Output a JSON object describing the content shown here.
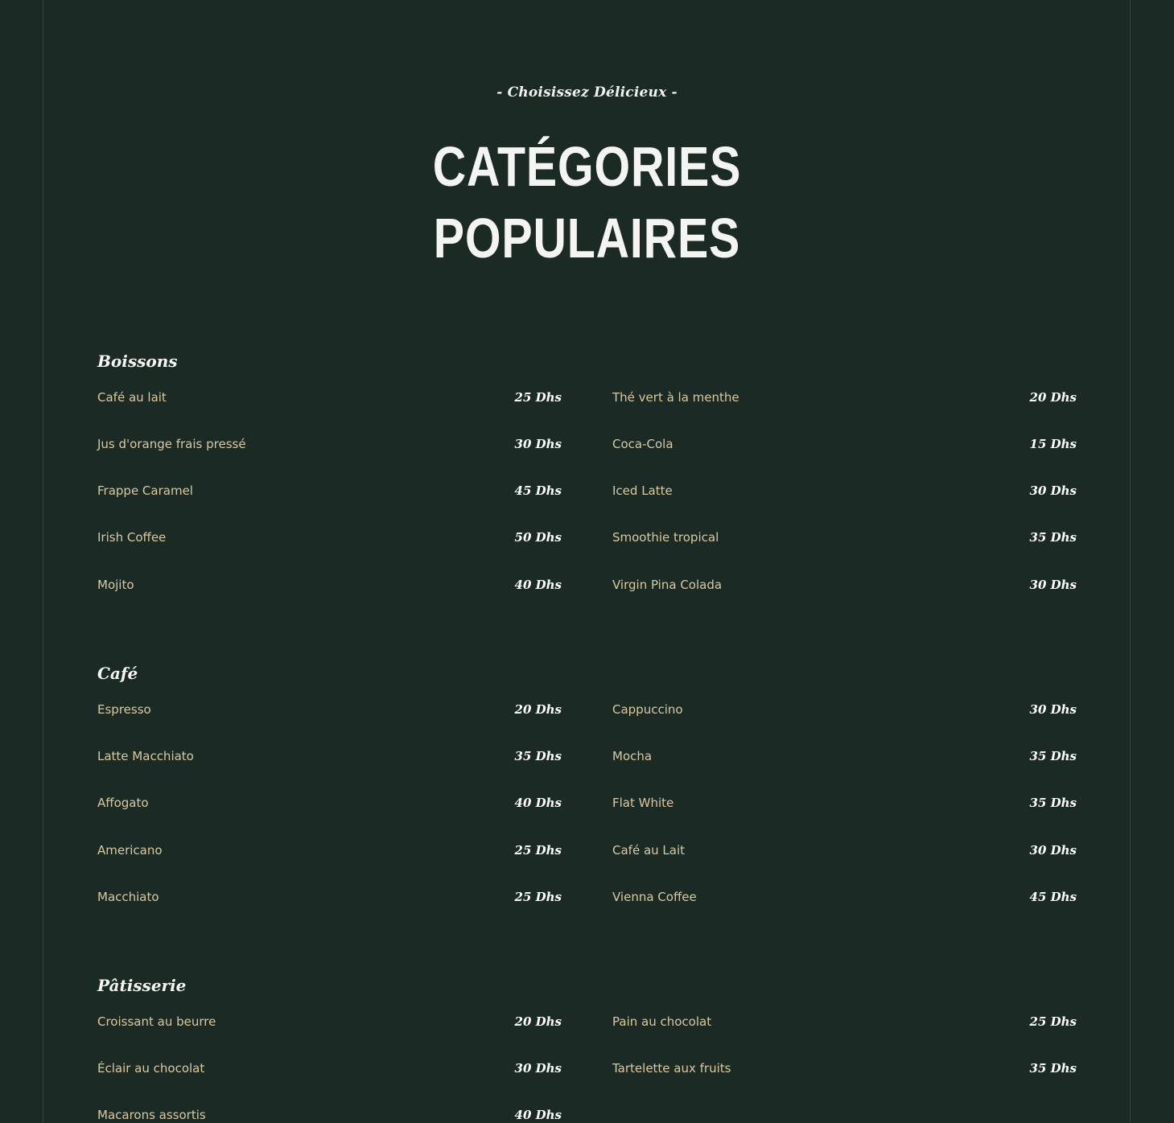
{
  "header": {
    "subtitle": "- Choisissez Délicieux -",
    "title_line1": "Catégories",
    "title_line2": "Populaires"
  },
  "colors": {
    "background": "#1b2a25",
    "item_name": "#d9c9a0",
    "price": "#ffffff",
    "heading": "#f4f4f2"
  },
  "categories": [
    {
      "name": "Boissons",
      "left": [
        {
          "name": "Café au lait",
          "price": "25 Dhs"
        },
        {
          "name": "Jus d'orange frais pressé",
          "price": "30 Dhs"
        },
        {
          "name": "Frappe Caramel",
          "price": "45 Dhs"
        },
        {
          "name": "Irish Coffee",
          "price": "50 Dhs"
        },
        {
          "name": "Mojito",
          "price": "40 Dhs"
        }
      ],
      "right": [
        {
          "name": "Thé vert à la menthe",
          "price": "20 Dhs"
        },
        {
          "name": "Coca-Cola",
          "price": "15 Dhs"
        },
        {
          "name": "Iced Latte",
          "price": "30 Dhs"
        },
        {
          "name": "Smoothie tropical",
          "price": "35 Dhs"
        },
        {
          "name": "Virgin Pina Colada",
          "price": "30 Dhs"
        }
      ]
    },
    {
      "name": "Café",
      "left": [
        {
          "name": "Espresso",
          "price": "20 Dhs"
        },
        {
          "name": "Latte Macchiato",
          "price": "35 Dhs"
        },
        {
          "name": "Affogato",
          "price": "40 Dhs"
        },
        {
          "name": "Americano",
          "price": "25 Dhs"
        },
        {
          "name": "Macchiato",
          "price": "25 Dhs"
        }
      ],
      "right": [
        {
          "name": "Cappuccino",
          "price": "30 Dhs"
        },
        {
          "name": "Mocha",
          "price": "35 Dhs"
        },
        {
          "name": "Flat White",
          "price": "35 Dhs"
        },
        {
          "name": "Café au Lait",
          "price": "30 Dhs"
        },
        {
          "name": "Vienna Coffee",
          "price": "45 Dhs"
        }
      ]
    },
    {
      "name": "Pâtisserie",
      "left": [
        {
          "name": "Croissant au beurre",
          "price": "20 Dhs"
        },
        {
          "name": "Éclair au chocolat",
          "price": "30 Dhs"
        },
        {
          "name": "Macarons assortis",
          "price": "40 Dhs"
        }
      ],
      "right": [
        {
          "name": "Pain au chocolat",
          "price": "25 Dhs"
        },
        {
          "name": "Tartelette aux fruits",
          "price": "35 Dhs"
        }
      ]
    }
  ]
}
